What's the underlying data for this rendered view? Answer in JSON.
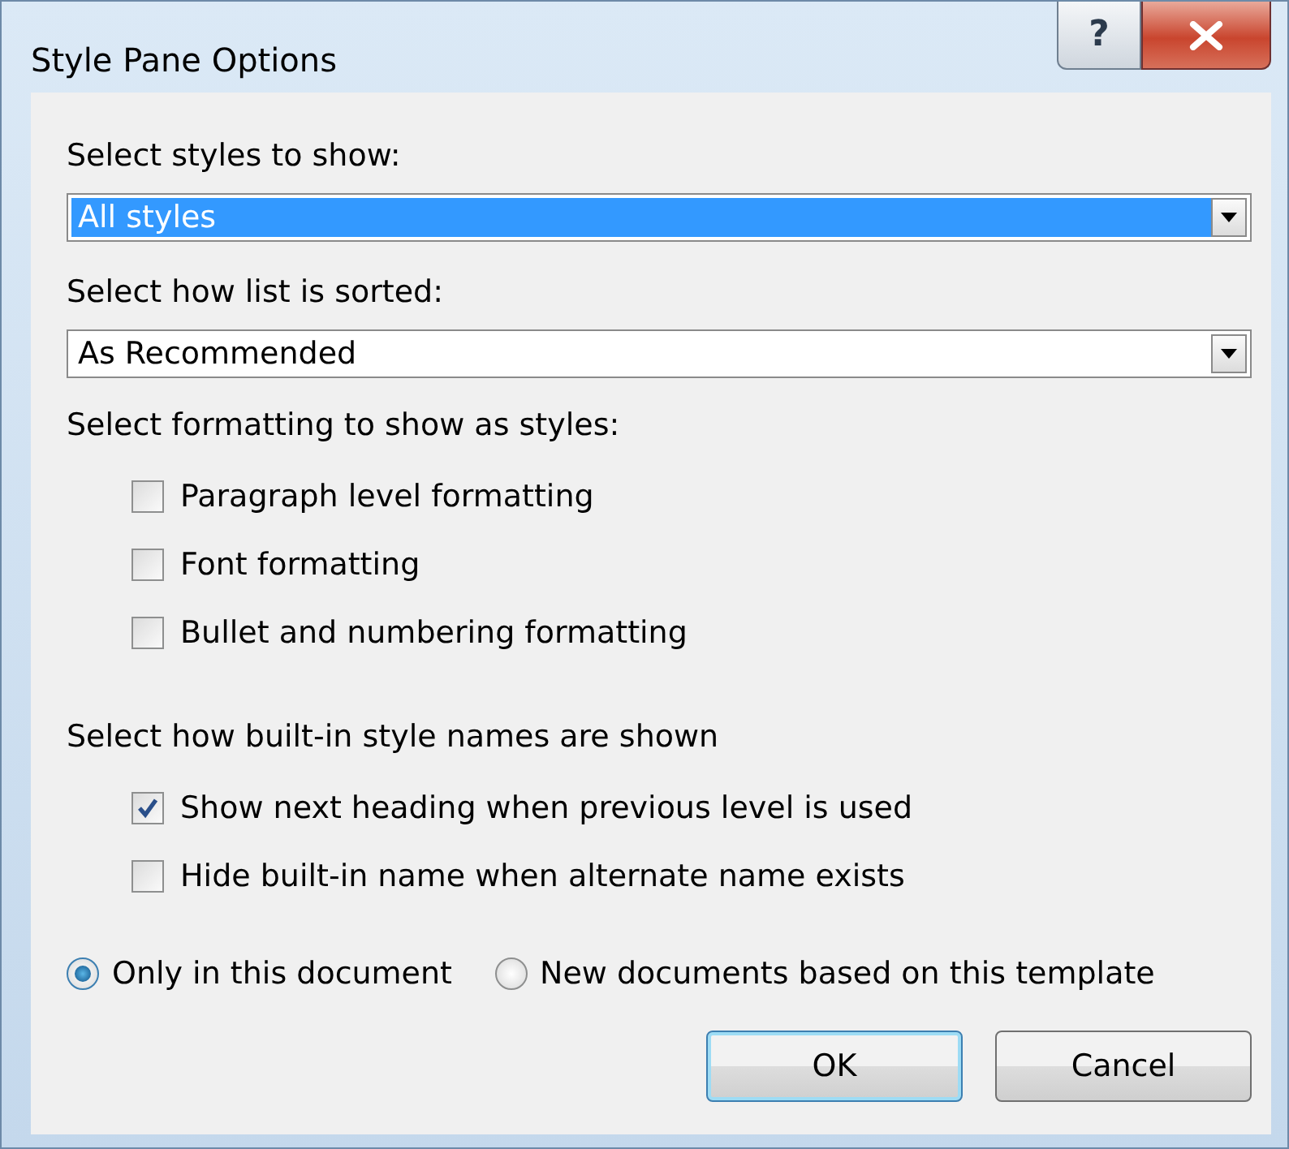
{
  "window": {
    "title": "Style Pane Options",
    "help": "?"
  },
  "styles_to_show": {
    "label": "Select styles to show:",
    "value": "All styles",
    "focused": true
  },
  "sort_order": {
    "label": "Select how list is sorted:",
    "value": "As Recommended",
    "focused": false
  },
  "formatting": {
    "label": "Select formatting to show as styles:",
    "options": [
      {
        "label": "Paragraph level formatting",
        "checked": false
      },
      {
        "label": "Font formatting",
        "checked": false
      },
      {
        "label": "Bullet and numbering formatting",
        "checked": false
      }
    ]
  },
  "builtin_names": {
    "label": "Select how built-in style names are shown",
    "options": [
      {
        "label": "Show next heading when previous level is used",
        "checked": true
      },
      {
        "label": "Hide built-in name when alternate name exists",
        "checked": false
      }
    ]
  },
  "scope": [
    {
      "label": "Only in this document",
      "selected": true
    },
    {
      "label": "New documents based on this template",
      "selected": false
    }
  ],
  "buttons": [
    {
      "label": "OK",
      "default": true
    },
    {
      "label": "Cancel",
      "default": false
    }
  ]
}
